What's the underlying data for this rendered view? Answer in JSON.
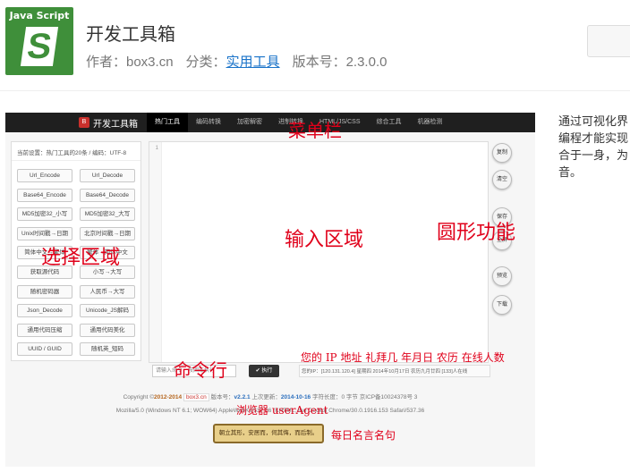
{
  "app": {
    "icon_title": "Java Script",
    "icon_letter": "S",
    "title": "开发工具箱",
    "author": "作者：box3.cn",
    "category_label": "分类：",
    "category_link": "实用工具",
    "version": "版本号：2.3.0.0"
  },
  "description": "通过可视化界\n编程才能实现\n合于一身，为\n音。",
  "screenshot": {
    "brand": "开发工具箱",
    "brand_badge": "B",
    "nav": [
      "热门工具",
      "编码转换",
      "加密解密",
      "进制转换",
      "HTML/JS/CSS",
      "综合工具",
      "机器检测"
    ],
    "panel_title": "当前设置：热门工具的20条  /  编码：UTF-8",
    "tool_buttons": [
      "Url_Encode",
      "Url_Decode",
      "Base64_Encode",
      "Base64_Decode",
      "MD5加密32_小写",
      "MD5加密32_大写",
      "Unix时间戳→日期",
      "北京时间戳→日期",
      "简体中文→繁体",
      "繁体→简体中文",
      "获取源代码",
      "小写→大写",
      "随机密码器",
      "人民币→大写",
      "Json_Decode",
      "Unicode_JS解码",
      "通用代码压缩",
      "通用代码美化",
      "UUID / GUID",
      "随机英_短码"
    ],
    "gutter_line": "1",
    "round_buttons": [
      "复制",
      "清空",
      "保存",
      "全屏",
      "预览",
      "下载"
    ],
    "cmd_placeholder": "请输入命令，按回车执行",
    "exec_label": "✔ 执行",
    "status": "您的IP：[120.131.120.4] 星期四  2014年10月17日  农历九月廿四  [133]人在线",
    "footer_copyright_prefix": "Copyright ©",
    "footer_year": "2012-2014",
    "footer_site": "box3.cn",
    "footer_version_label": "版本号：",
    "footer_version": "v2.2.1",
    "footer_updated_label": "上次更新：",
    "footer_updated": "2014-10-16",
    "footer_tail": "字符长度：0 字节  京ICP备10024378号 3",
    "user_agent": "Mozilla/5.0 (Windows NT 6.1; WOW64) AppleWebKit/537.36 (KHTML, like Gecko) Chrome/30.0.1916.153 Safari/537.36",
    "scroll_quote": "朝立其形，安居而，伺其悔，而后制。"
  },
  "annotations": {
    "menu": "菜单栏",
    "input_area": "输入区域",
    "round_func": "圆形功能",
    "select_area": "选择区域",
    "cmd_line": "命令行",
    "status_info": "您的 IP 地址 礼拜几 年月日 农历 在线人数",
    "browser": "浏览器 userAgent",
    "quote": "每日名言名句"
  }
}
